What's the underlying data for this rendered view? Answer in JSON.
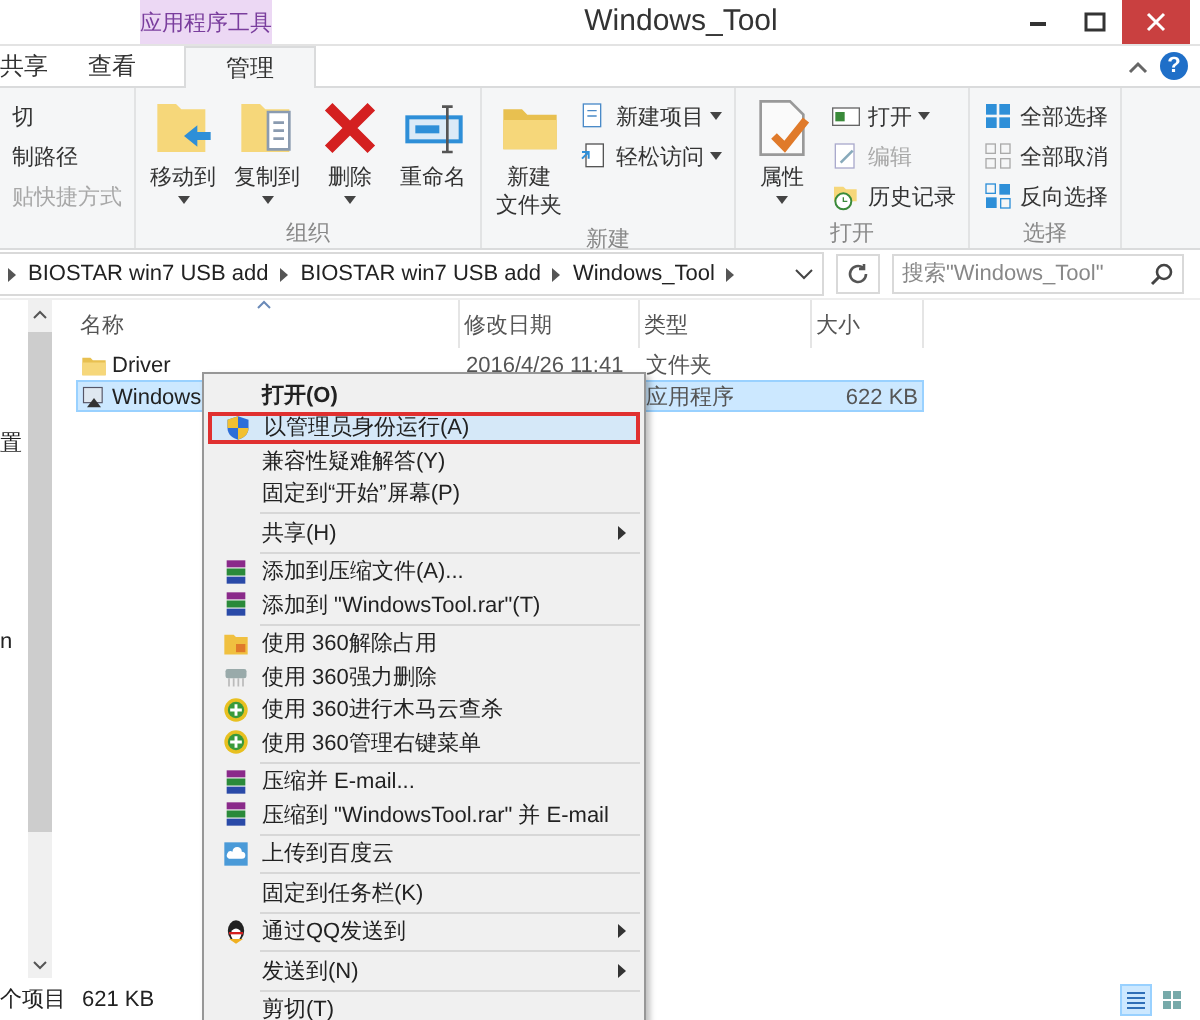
{
  "window": {
    "title": "Windows_Tool",
    "context_tab": "应用程序工具",
    "help": "?"
  },
  "tabs": [
    {
      "label": "共享",
      "selected": false
    },
    {
      "label": "查看",
      "selected": false
    },
    {
      "label": "管理",
      "selected": true
    }
  ],
  "ribbon": {
    "groups": [
      {
        "small": [
          {
            "label": "切",
            "kind": "plain",
            "dropdown": false,
            "disabled": false
          },
          {
            "label": "制路径",
            "kind": "plain",
            "dropdown": false,
            "disabled": false
          },
          {
            "label": "贴快捷方式",
            "kind": "plain",
            "dropdown": false,
            "disabled": true
          }
        ]
      },
      {
        "label": "组织",
        "large": [
          {
            "label": "移动到",
            "kind": "move",
            "dropdown": true
          },
          {
            "label": "复制到",
            "kind": "copy",
            "dropdown": true
          },
          {
            "label": "删除",
            "kind": "delete",
            "dropdown": true
          },
          {
            "label": "重命名",
            "kind": "rename",
            "dropdown": false
          }
        ]
      },
      {
        "label": "新建",
        "large": [
          {
            "label": "新建文件夹",
            "kind": "new-folder",
            "dropdown": false
          }
        ],
        "small": [
          {
            "label": "新建项目",
            "kind": "new-item",
            "dropdown": true,
            "disabled": false
          },
          {
            "label": "轻松访问",
            "kind": "easy-access",
            "dropdown": true,
            "disabled": false
          }
        ]
      },
      {
        "label": "打开",
        "large": [
          {
            "label": "属性",
            "kind": "properties",
            "dropdown": true
          }
        ],
        "small": [
          {
            "label": "打开",
            "kind": "open",
            "dropdown": true,
            "disabled": false
          },
          {
            "label": "编辑",
            "kind": "edit",
            "dropdown": false,
            "disabled": true
          },
          {
            "label": "历史记录",
            "kind": "history",
            "dropdown": false,
            "disabled": false
          }
        ]
      },
      {
        "label": "选择",
        "small": [
          {
            "label": "全部选择",
            "kind": "select-all",
            "dropdown": false,
            "disabled": false
          },
          {
            "label": "全部取消",
            "kind": "select-none",
            "dropdown": false,
            "disabled": false
          },
          {
            "label": "反向选择",
            "kind": "invert",
            "dropdown": false,
            "disabled": false
          }
        ]
      }
    ]
  },
  "address": {
    "crumbs": [
      "BIOSTAR win7 USB add",
      "BIOSTAR win7 USB add",
      "Windows_Tool"
    ],
    "search_placeholder": "搜索\"Windows_Tool\""
  },
  "nav_pane": {
    "items": [
      "置",
      "n"
    ]
  },
  "files": {
    "columns": [
      "名称",
      "修改日期",
      "类型",
      "大小"
    ],
    "rows": [
      {
        "name": "Driver",
        "kind": "folder",
        "date": "2016/4/26 11:41",
        "type": "文件夹",
        "selected": false
      },
      {
        "name": "Windows",
        "kind": "program",
        "type": "应用程序",
        "size": "622 KB",
        "selected": true
      }
    ]
  },
  "status_bar": {
    "count": "个项目",
    "size": "621 KB",
    "views": [
      {
        "kind": "details",
        "selected": true
      },
      {
        "kind": "icons",
        "selected": false
      }
    ]
  },
  "context_menu": {
    "items": [
      {
        "kind": "plain",
        "label": "打开(O)",
        "bold": true,
        "submenu": false,
        "selected": false
      },
      {
        "kind": "shield",
        "label": "以管理员身份运行(A)",
        "bold": false,
        "submenu": false,
        "selected": true
      },
      {
        "kind": "plain",
        "label": "兼容性疑难解答(Y)",
        "bold": false,
        "submenu": false,
        "selected": false
      },
      {
        "kind": "plain",
        "label": "固定到“开始”屏幕(P)",
        "bold": false,
        "submenu": false,
        "selected": false
      },
      {
        "kind": "separator"
      },
      {
        "kind": "plain",
        "label": "共享(H)",
        "bold": false,
        "submenu": true,
        "selected": false
      },
      {
        "kind": "separator"
      },
      {
        "kind": "rar",
        "label": "添加到压缩文件(A)...",
        "bold": false,
        "submenu": false,
        "selected": false
      },
      {
        "kind": "rar",
        "label": "添加到 \"WindowsTool.rar\"(T)",
        "bold": false,
        "submenu": false,
        "selected": false
      },
      {
        "kind": "separator"
      },
      {
        "kind": "unlock",
        "label": "使用 360解除占用",
        "bold": false,
        "submenu": false,
        "selected": false
      },
      {
        "kind": "shred",
        "label": "使用 360强力删除",
        "bold": false,
        "submenu": false,
        "selected": false
      },
      {
        "kind": "plus",
        "label": "使用 360进行木马云查杀",
        "bold": false,
        "submenu": false,
        "selected": false
      },
      {
        "kind": "plus",
        "label": "使用 360管理右键菜单",
        "bold": false,
        "submenu": false,
        "selected": false
      },
      {
        "kind": "separator"
      },
      {
        "kind": "rar",
        "label": "压缩并 E-mail...",
        "bold": false,
        "submenu": false,
        "selected": false
      },
      {
        "kind": "rar",
        "label": "压缩到 \"WindowsTool.rar\" 并 E-mail",
        "bold": false,
        "submenu": false,
        "selected": false
      },
      {
        "kind": "separator"
      },
      {
        "kind": "cloud",
        "label": "上传到百度云",
        "bold": false,
        "submenu": false,
        "selected": false
      },
      {
        "kind": "separator"
      },
      {
        "kind": "plain",
        "label": "固定到任务栏(K)",
        "bold": false,
        "submenu": false,
        "selected": false
      },
      {
        "kind": "separator"
      },
      {
        "kind": "qq",
        "label": "通过QQ发送到",
        "bold": false,
        "submenu": true,
        "selected": false
      },
      {
        "kind": "separator"
      },
      {
        "kind": "plain",
        "label": "发送到(N)",
        "bold": false,
        "submenu": true,
        "selected": false
      },
      {
        "kind": "separator"
      },
      {
        "kind": "plain",
        "label": "剪切(T)",
        "bold": false,
        "submenu": false,
        "selected": false
      }
    ]
  }
}
